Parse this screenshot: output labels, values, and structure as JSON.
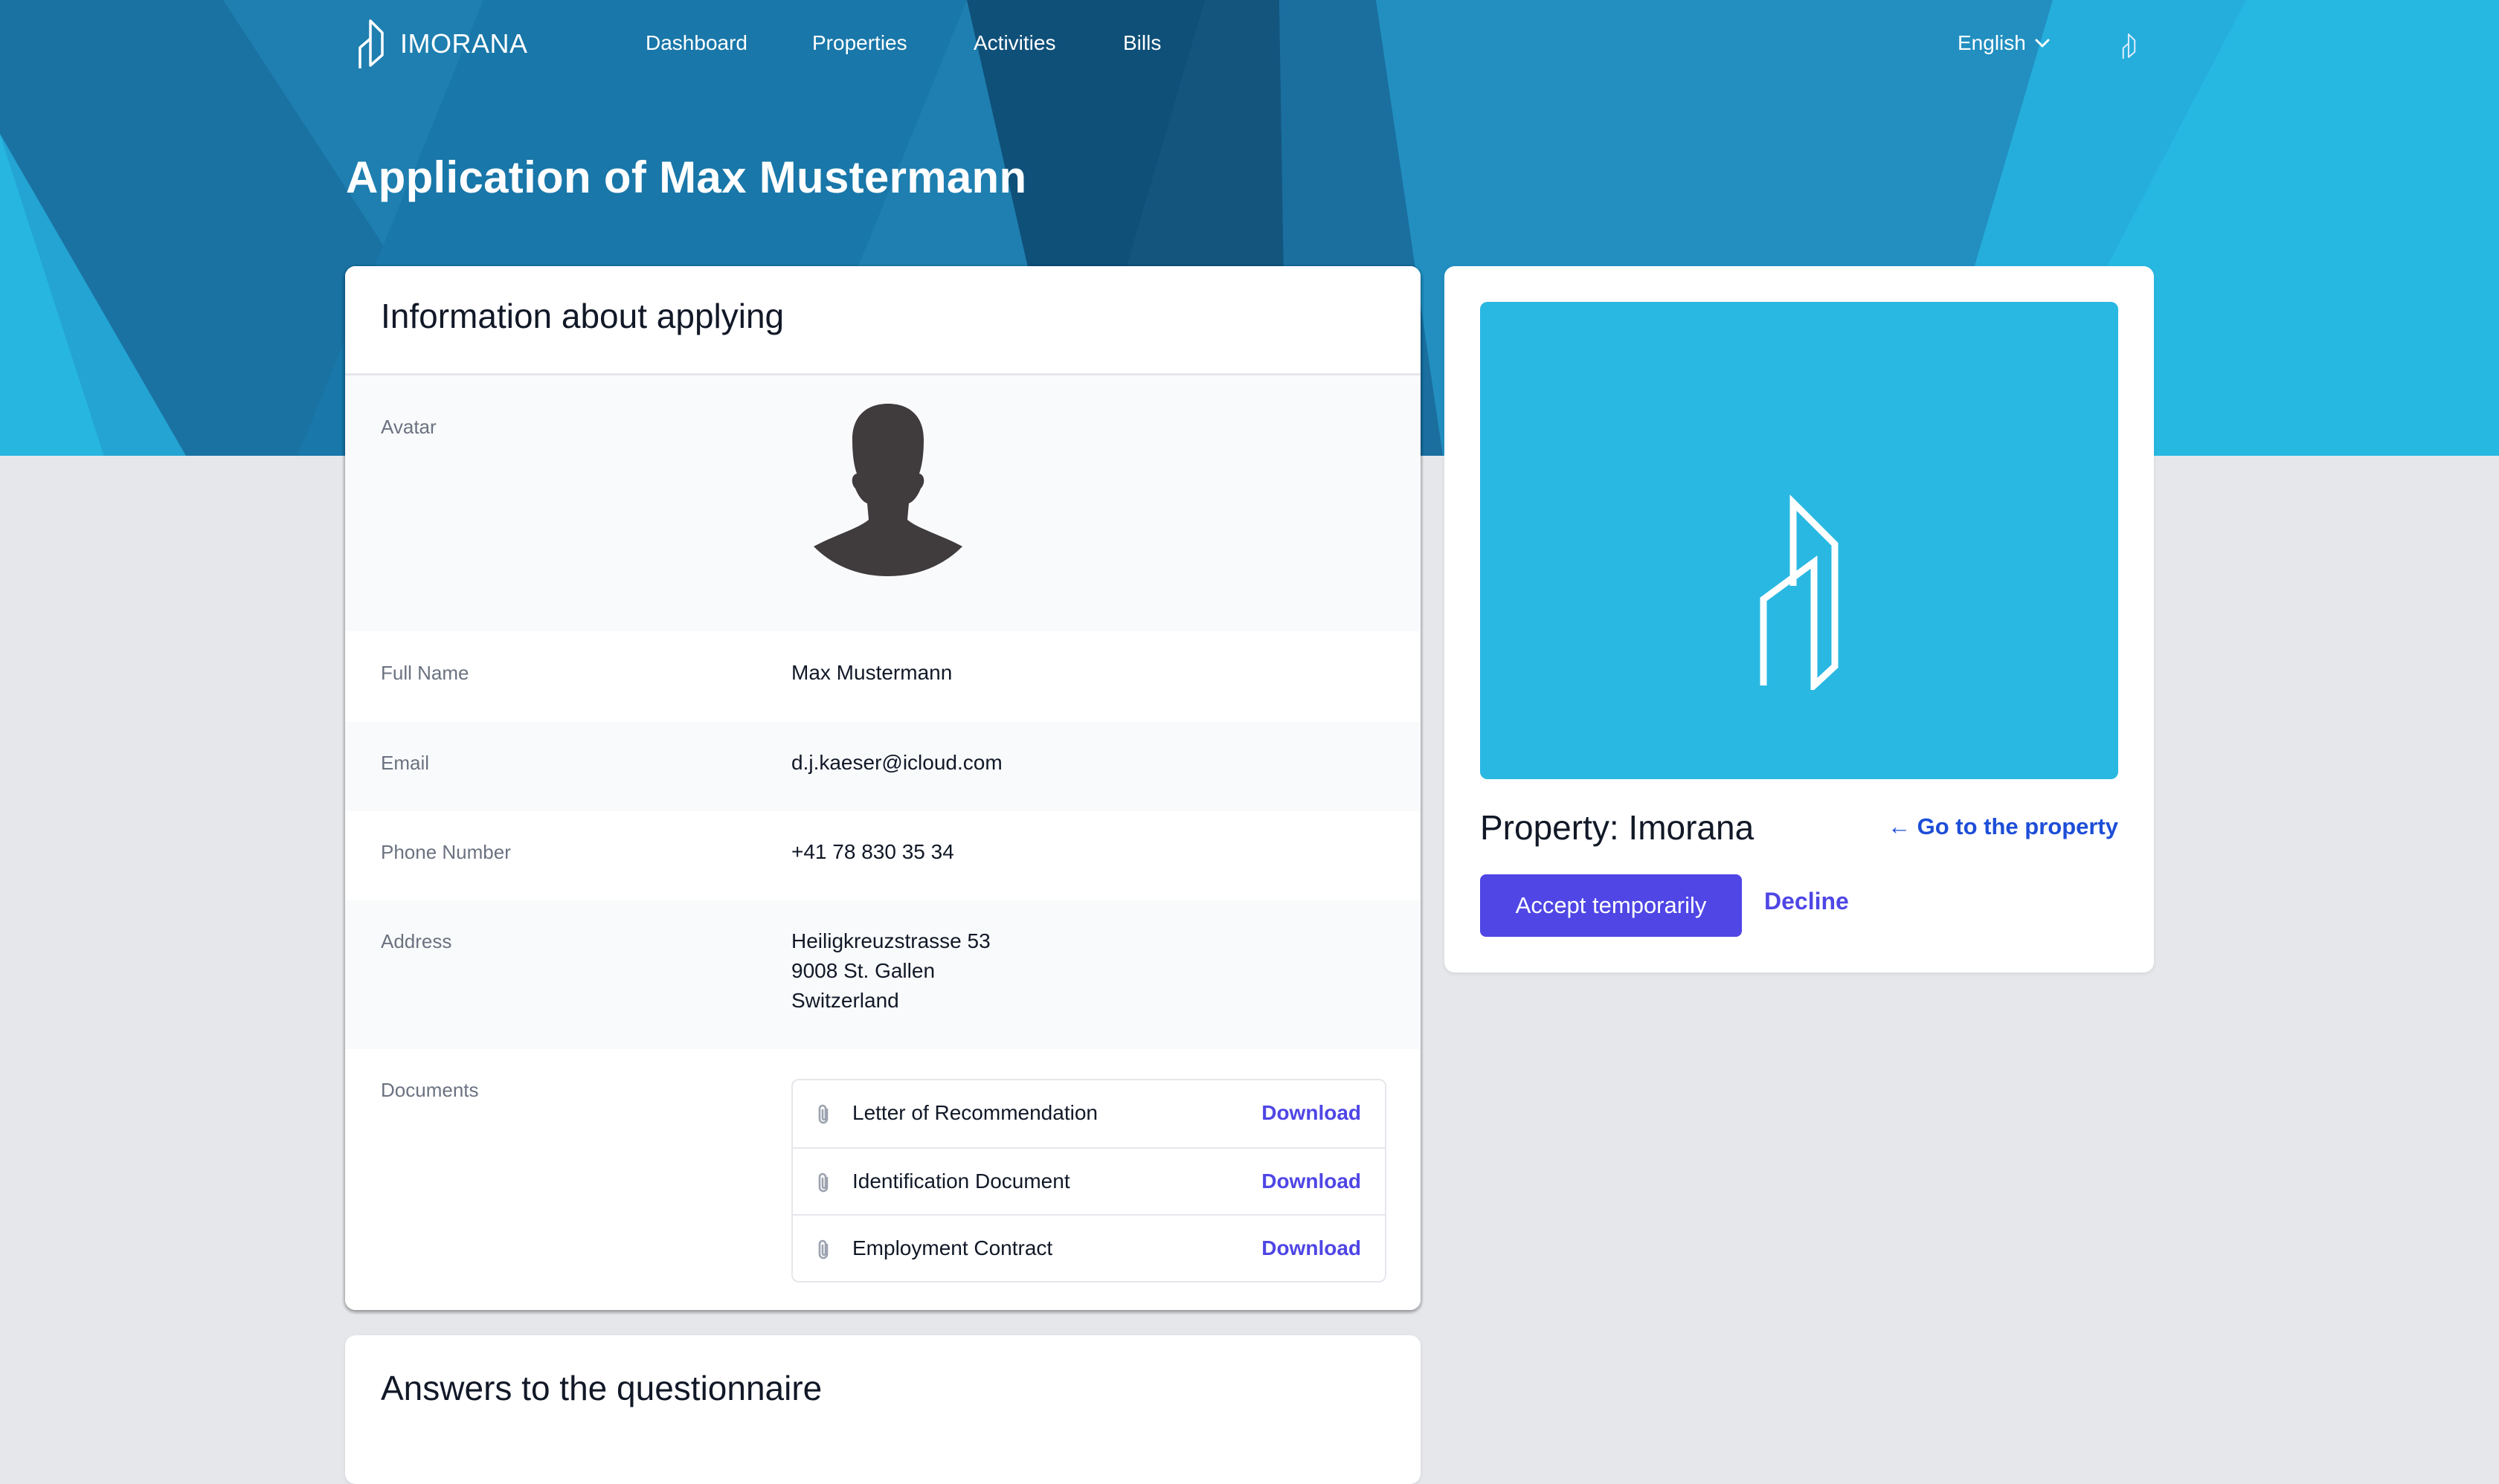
{
  "header": {
    "brand": "IMORANA",
    "nav": [
      {
        "label": "Dashboard"
      },
      {
        "label": "Properties"
      },
      {
        "label": "Activities"
      },
      {
        "label": "Bills"
      }
    ],
    "language": "English"
  },
  "page": {
    "title": "Application of Max Mustermann"
  },
  "applicant": {
    "card_title": "Information about applying",
    "avatar_label": "Avatar",
    "fields": [
      {
        "label": "Full Name",
        "value": "Max Mustermann"
      },
      {
        "label": "Email",
        "value": "d.j.kaeser@icloud.com"
      },
      {
        "label": "Phone Number",
        "value": "+41 78 830 35 34"
      }
    ],
    "address": {
      "label": "Address",
      "lines": [
        "Heiligkreuzstrasse 53",
        "9008 St. Gallen",
        "Switzerland"
      ]
    },
    "documents": {
      "label": "Documents",
      "items": [
        {
          "name": "Letter of Recommendation",
          "action": "Download"
        },
        {
          "name": "Identification Document",
          "action": "Download"
        },
        {
          "name": "Employment Contract",
          "action": "Download"
        }
      ]
    }
  },
  "property": {
    "title": "Property: Imorana",
    "goto_link": "← Go to the property",
    "accept_button": "Accept temporarily",
    "decline_button": "Decline"
  },
  "questionnaire": {
    "title": "Answers to the questionnaire"
  },
  "colors": {
    "hero_dark": "#1e7fb0",
    "hero_light": "#27b6e0",
    "accent": "#4f46e5",
    "property_tile": "#29b8e2"
  }
}
